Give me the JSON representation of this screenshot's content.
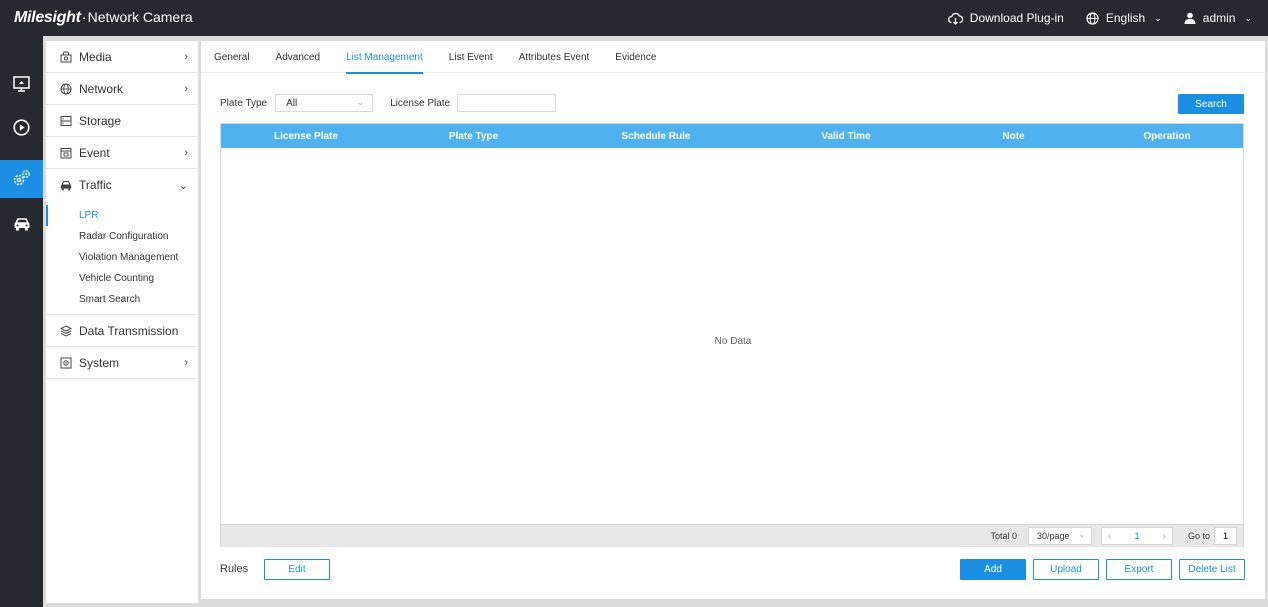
{
  "header": {
    "brand_logo": "Milesight",
    "brand_dot": "·",
    "brand_product": "Network Camera",
    "download_label": "Download Plug-in",
    "language_label": "English",
    "user_label": "admin",
    "caret": "⌄"
  },
  "rail": {
    "items": [
      {
        "icon": "monitor-icon"
      },
      {
        "icon": "playback-icon"
      },
      {
        "icon": "settings-icon",
        "active": true
      },
      {
        "icon": "vehicle-icon"
      }
    ]
  },
  "menu": {
    "items": [
      {
        "label": "Media",
        "icon": "media-icon",
        "chevron": "›"
      },
      {
        "label": "Network",
        "icon": "globe-icon",
        "chevron": "›"
      },
      {
        "label": "Storage",
        "icon": "storage-icon"
      },
      {
        "label": "Event",
        "icon": "event-icon",
        "chevron": "›"
      },
      {
        "label": "Traffic",
        "icon": "car-icon",
        "chevron": "⌄"
      }
    ],
    "traffic_sub": [
      {
        "label": "LPR",
        "active": true
      },
      {
        "label": "Radar Configuration"
      },
      {
        "label": "Violation Management"
      },
      {
        "label": "Vehicle Counting"
      },
      {
        "label": "Smart Search"
      }
    ],
    "bottom_items": [
      {
        "label": "Data Transmission",
        "icon": "layers-icon"
      },
      {
        "label": "System",
        "icon": "system-icon",
        "chevron": "›"
      }
    ]
  },
  "tabs": [
    "General",
    "Advanced",
    "List Management",
    "List Event",
    "Attributes Event",
    "Evidence"
  ],
  "active_tab": "List Management",
  "filters": {
    "plate_type_label": "Plate Type",
    "plate_type_value": "All",
    "license_plate_label": "License Plate",
    "license_plate_value": "",
    "search_button": "Search"
  },
  "table": {
    "columns": [
      "License Plate",
      "Plate Type",
      "Schedule Rule",
      "Valid Time",
      "Note",
      "Operation"
    ],
    "rows": [],
    "empty_text": "No Data"
  },
  "pagination": {
    "total_label": "Total 0",
    "page_size": "30/page",
    "prev": "‹",
    "current_page": "1",
    "next": "›",
    "goto_label": "Go to",
    "goto_value": "1"
  },
  "footer": {
    "rules_label": "Rules",
    "edit_button": "Edit",
    "add_button": "Add",
    "upload_button": "Upload",
    "export_button": "Export",
    "delete_button": "Delete List"
  },
  "colors": {
    "accent": "#1a8fe3",
    "table_header": "#4fb1f0",
    "topbar": "#262a30"
  }
}
